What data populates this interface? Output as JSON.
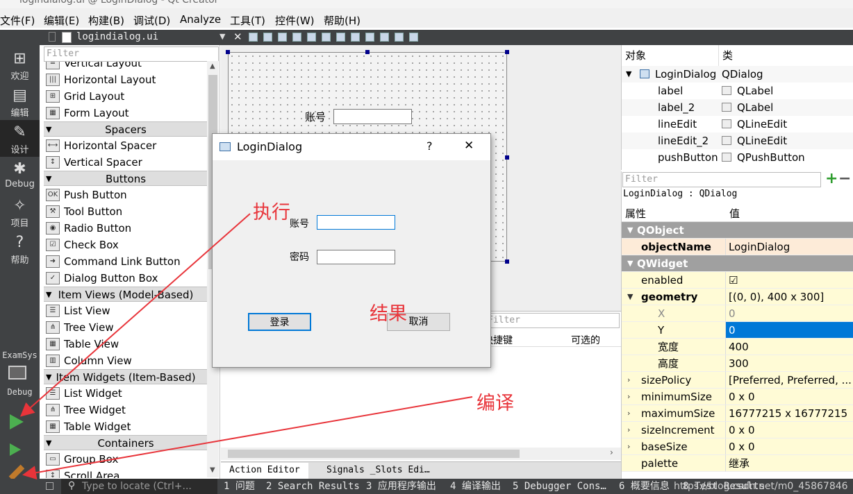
{
  "window_title": "logindialog.ui @ LoginDialog - Qt Creator",
  "menu": [
    "文件(F)",
    "编辑(E)",
    "构建(B)",
    "调试(D)",
    "Analyze",
    "工具(T)",
    "控件(W)",
    "帮助(H)"
  ],
  "editor": {
    "filename": "logindialog.ui"
  },
  "modes": [
    {
      "label": "欢迎",
      "icon": "grid-icon"
    },
    {
      "label": "编辑",
      "icon": "edit-icon"
    },
    {
      "label": "设计",
      "icon": "pencil-icon"
    },
    {
      "label": "Debug",
      "icon": "bug-icon"
    },
    {
      "label": "项目",
      "icon": "wrench-icon"
    },
    {
      "label": "帮助",
      "icon": "help-icon"
    }
  ],
  "kit": {
    "project": "ExamSys",
    "config": "Debug"
  },
  "widget_box": {
    "filter_placeholder": "Filter",
    "entries": [
      {
        "kind": "item",
        "label": "Vertical Layout"
      },
      {
        "kind": "item",
        "label": "Horizontal Layout"
      },
      {
        "kind": "item",
        "label": "Grid Layout"
      },
      {
        "kind": "item",
        "label": "Form Layout"
      },
      {
        "kind": "cat",
        "label": "Spacers"
      },
      {
        "kind": "item",
        "label": "Horizontal Spacer"
      },
      {
        "kind": "item",
        "label": "Vertical Spacer"
      },
      {
        "kind": "cat",
        "label": "Buttons"
      },
      {
        "kind": "item",
        "label": "Push Button"
      },
      {
        "kind": "item",
        "label": "Tool Button"
      },
      {
        "kind": "item",
        "label": "Radio Button"
      },
      {
        "kind": "item",
        "label": "Check Box"
      },
      {
        "kind": "item",
        "label": "Command Link Button"
      },
      {
        "kind": "item",
        "label": "Dialog Button Box"
      },
      {
        "kind": "cat",
        "label": "Item Views (Model-Based)"
      },
      {
        "kind": "item",
        "label": "List View"
      },
      {
        "kind": "item",
        "label": "Tree View"
      },
      {
        "kind": "item",
        "label": "Table View"
      },
      {
        "kind": "item",
        "label": "Column View"
      },
      {
        "kind": "cat",
        "label": "Item Widgets (Item-Based)"
      },
      {
        "kind": "item",
        "label": "List Widget"
      },
      {
        "kind": "item",
        "label": "Tree Widget"
      },
      {
        "kind": "item",
        "label": "Table Widget"
      },
      {
        "kind": "cat",
        "label": "Containers"
      },
      {
        "kind": "item",
        "label": "Group Box"
      },
      {
        "kind": "item",
        "label": "Scroll Area"
      }
    ]
  },
  "form": {
    "account_label": "账号"
  },
  "action_editor": {
    "filter_placeholder": "Filter",
    "col_shortcut": "快捷键",
    "col_checkable": "可选的",
    "tabs": [
      "Action Editor",
      "Signals _Slots Edi…"
    ]
  },
  "object_inspector": {
    "headers": [
      "对象",
      "类"
    ],
    "rows": [
      {
        "name": "LoginDialog",
        "class": "QDialog"
      },
      {
        "name": "label",
        "class": "QLabel"
      },
      {
        "name": "label_2",
        "class": "QLabel"
      },
      {
        "name": "lineEdit",
        "class": "QLineEdit"
      },
      {
        "name": "lineEdit_2",
        "class": "QLineEdit"
      },
      {
        "name": "pushButton",
        "class": "QPushButton"
      }
    ]
  },
  "property_editor": {
    "filter_placeholder": "Filter",
    "context": "LoginDialog : QDialog",
    "headers": [
      "属性",
      "值"
    ],
    "rows": [
      {
        "kind": "group",
        "name": "QObject",
        "value": ""
      },
      {
        "kind": "obj",
        "name": "objectName",
        "value": "LoginDialog"
      },
      {
        "kind": "group",
        "name": "QWidget",
        "value": ""
      },
      {
        "kind": "prop",
        "name": "enabled",
        "value": "☑"
      },
      {
        "kind": "prop-exp",
        "name": "geometry",
        "value": "[(0, 0), 400 x 300]"
      },
      {
        "kind": "sub",
        "name": "X",
        "value": "0"
      },
      {
        "kind": "sel",
        "name": "Y",
        "value": "0"
      },
      {
        "kind": "sub2",
        "name": "宽度",
        "value": "400"
      },
      {
        "kind": "sub2",
        "name": "高度",
        "value": "300"
      },
      {
        "kind": "prop-col",
        "name": "sizePolicy",
        "value": "[Preferred, Preferred, ..."
      },
      {
        "kind": "prop-col",
        "name": "minimumSize",
        "value": "0 x 0"
      },
      {
        "kind": "prop-col",
        "name": "maximumSize",
        "value": "16777215 x 16777215"
      },
      {
        "kind": "prop-col",
        "name": "sizeIncrement",
        "value": "0 x 0"
      },
      {
        "kind": "prop-col",
        "name": "baseSize",
        "value": "0 x 0"
      },
      {
        "kind": "prop",
        "name": "palette",
        "value": "继承"
      }
    ]
  },
  "login_dialog": {
    "title": "LoginDialog",
    "help": "?",
    "close": "✕",
    "account_label": "账号",
    "password_label": "密码",
    "login_button": "登录",
    "cancel_button": "取消"
  },
  "annotations": {
    "execute": "执行",
    "result": "结果",
    "compile": "编译"
  },
  "status_bar": {
    "locator_placeholder": "Type to locate (Ctrl+...",
    "panes": [
      "1 问题",
      "2 Search Results",
      "3 应用程序输出",
      "4 编译输出",
      "5 Debugger Cons…",
      "6 概要信息",
      "8 Test Results"
    ],
    "watermark": "https://blog.csdn.net/m0_45867846"
  }
}
